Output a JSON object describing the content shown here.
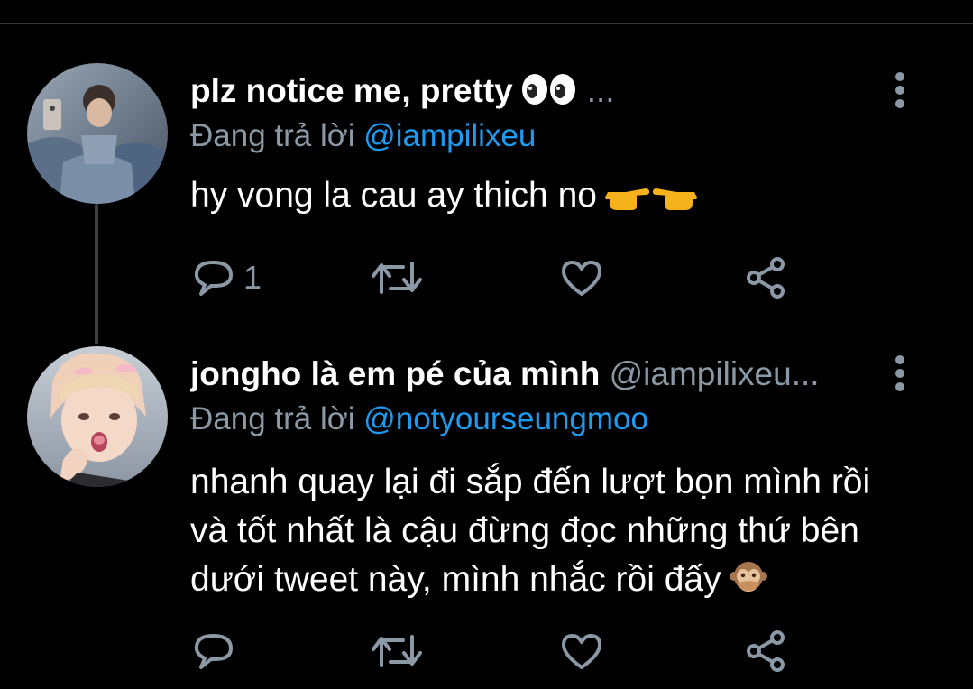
{
  "theme": {
    "background": "#000000",
    "link_color": "#1d9bf0",
    "muted_color": "#8b98a5",
    "text_color": "#ffffff"
  },
  "tweets": [
    {
      "display_name": "plz notice me, pretty",
      "name_emoji": "eyes",
      "handle": "...",
      "reply_prefix": "Đang trả lời",
      "reply_to": "@iampilixeu",
      "text": "hy vong la cau ay thich no",
      "text_emoji": "pointing-hands",
      "reply_count": "1",
      "icons": {
        "reply": "reply-icon",
        "retweet": "retweet-icon",
        "like": "heart-icon",
        "share": "share-icon",
        "more": "more-vertical-icon"
      }
    },
    {
      "display_name": "jongho là em pé của mình",
      "handle": "@iampilixeu...",
      "reply_prefix": "Đang trả lời",
      "reply_to": "@notyourseungmoo",
      "text": "nhanh quay lại đi sắp đến lượt bọn mình rồi và tốt nhất là cậu đừng đọc những thứ bên dưới tweet này, mình nhắc rồi đấy",
      "text_emoji": "speak-no-evil-monkey",
      "reply_count": "",
      "icons": {
        "reply": "reply-icon",
        "retweet": "retweet-icon",
        "like": "heart-icon",
        "share": "share-icon",
        "more": "more-vertical-icon"
      }
    }
  ]
}
